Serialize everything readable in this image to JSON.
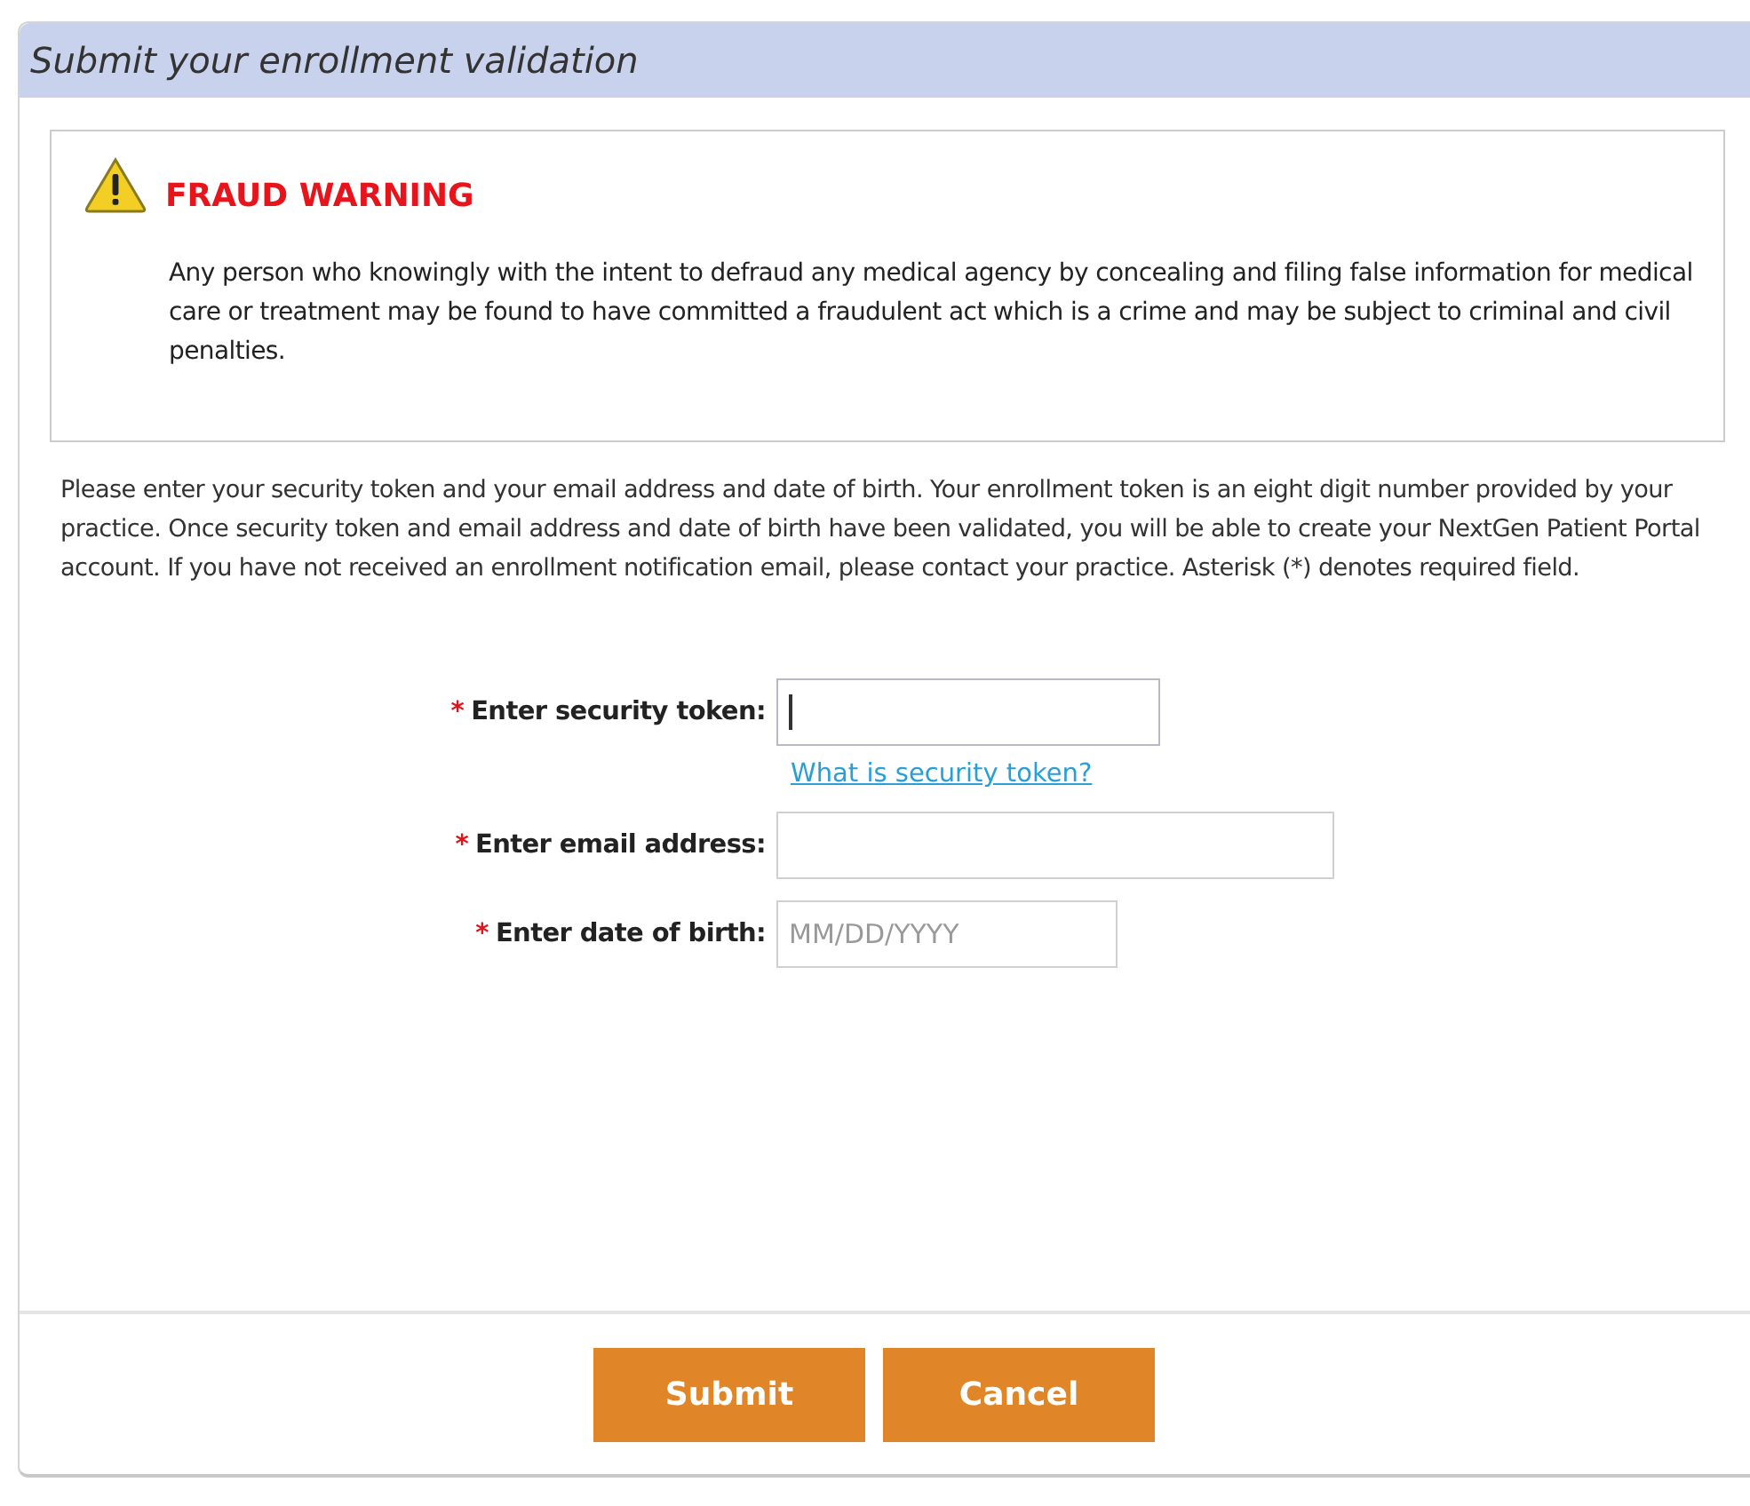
{
  "dialog": {
    "title": "Submit your enrollment validation"
  },
  "warning": {
    "title": "FRAUD WARNING",
    "text": "Any person who knowingly with the intent to defraud any medical agency by concealing and filing false information for medical care or treatment may be found to have committed a fraudulent act which is a crime and may be subject to criminal and civil penalties."
  },
  "instructions": "Please enter your security token and your email address and date of birth. Your enrollment token is an eight digit number provided by your practice. Once security token and email address and date of birth have been validated, you will be able to create your NextGen Patient Portal account. If you have not received an enrollment notification email, please contact your practice. Asterisk (*) denotes required field.",
  "fields": [
    {
      "asterisk": "*",
      "label": "Enter security token:",
      "focused": true,
      "help_link": "What is security token?"
    },
    {
      "asterisk": "*",
      "label": "Enter email address:",
      "focused": false
    },
    {
      "asterisk": "*",
      "label": "Enter date of birth:",
      "focused": false,
      "placeholder": "MM/DD/YYYY"
    }
  ],
  "buttons": [
    "Submit",
    "Cancel"
  ]
}
